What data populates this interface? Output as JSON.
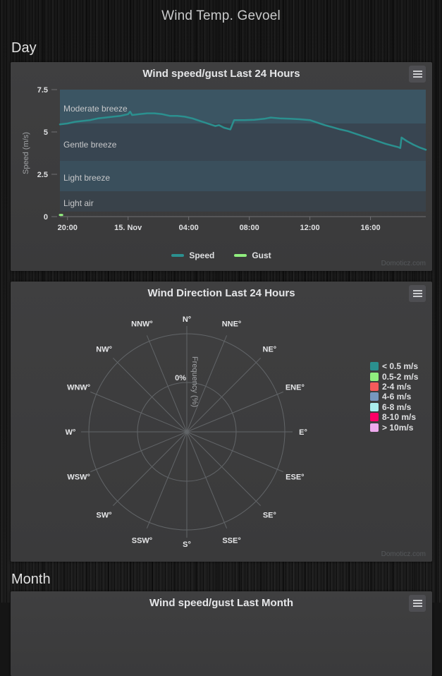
{
  "page": {
    "title": "Wind Temp. Gevoel",
    "sections": {
      "day": "Day",
      "month": "Month"
    },
    "watermark": "Domoticz.com"
  },
  "wind_speed_chart": {
    "title": "Wind speed/gust Last 24 Hours",
    "y_axis": {
      "title": "Speed (m/s)",
      "ticks": [
        {
          "label": "7.5",
          "v": 7.5
        },
        {
          "label": "5",
          "v": 5
        },
        {
          "label": "2.5",
          "v": 2.5
        },
        {
          "label": "0",
          "v": 0
        }
      ]
    },
    "x_ticks": [
      {
        "label": "20:00",
        "min": 30
      },
      {
        "label": "15. Nov",
        "min": 270
      },
      {
        "label": "04:00",
        "min": 510
      },
      {
        "label": "08:00",
        "min": 750
      },
      {
        "label": "12:00",
        "min": 990
      },
      {
        "label": "16:00",
        "min": 1230
      }
    ],
    "bands": [
      {
        "label": "Moderate breeze",
        "from": 5.5,
        "to": 7.5,
        "color": "#3b5563",
        "label_v": 6.2
      },
      {
        "label": "Gentle breeze",
        "from": 3.3,
        "to": 5.5,
        "color": "#384551",
        "label_v": 4.08
      },
      {
        "label": "Light breeze",
        "from": 1.5,
        "to": 3.3,
        "color": "#3a4f5c",
        "label_v": 2.12
      },
      {
        "label": "Light air",
        "from": 0.3,
        "to": 1.5,
        "color": "#39424a",
        "label_v": 0.62
      }
    ],
    "legend": [
      {
        "label": "Speed",
        "color": "#2b908f"
      },
      {
        "label": "Gust",
        "color": "#90ee7e"
      }
    ]
  },
  "wind_direction_chart": {
    "title": "Wind Direction Last 24 Hours",
    "axis_title": "Frequency (%)",
    "tick_label": "0%",
    "labels": [
      "N°",
      "NNE°",
      "NE°",
      "ENE°",
      "E°",
      "ESE°",
      "SE°",
      "SSE°",
      "S°",
      "SSW°",
      "SW°",
      "WSW°",
      "W°",
      "WNW°",
      "NW°",
      "NNW°"
    ],
    "legend": [
      {
        "label": "< 0.5 m/s",
        "color": "#2b908f"
      },
      {
        "label": "0.5-2 m/s",
        "color": "#90ee7e"
      },
      {
        "label": "2-4 m/s",
        "color": "#f45b5b"
      },
      {
        "label": "4-6 m/s",
        "color": "#7798bf"
      },
      {
        "label": "6-8 m/s",
        "color": "#aaeeee"
      },
      {
        "label": "8-10 m/s",
        "color": "#ff0066"
      },
      {
        "label": "> 10m/s",
        "color": "#eeaaee"
      }
    ]
  },
  "month_chart": {
    "title": "Wind speed/gust Last Month"
  },
  "chart_data": [
    {
      "type": "line",
      "title": "Wind speed/gust Last 24 Hours",
      "xlabel": "",
      "ylabel": "Speed (m/s)",
      "ylim": [
        0,
        7.5
      ],
      "x_span_minutes": 1449,
      "x_start_time": "19:30",
      "x_tick_labels": [
        "20:00",
        "15. Nov",
        "04:00",
        "08:00",
        "12:00",
        "16:00"
      ],
      "plot_band_labels": [
        "Moderate breeze",
        "Gentle breeze",
        "Light breeze",
        "Light air"
      ],
      "legend_position": "bottom",
      "grid": false,
      "series": [
        {
          "name": "Speed",
          "color": "#2b908f",
          "points": [
            [
              "19:30",
              5.45
            ],
            [
              "20:00",
              5.5
            ],
            [
              "20:30",
              5.6
            ],
            [
              "21:00",
              5.65
            ],
            [
              "21:30",
              5.7
            ],
            [
              "22:00",
              5.8
            ],
            [
              "22:30",
              5.85
            ],
            [
              "23:00",
              5.9
            ],
            [
              "23:30",
              5.95
            ],
            [
              "00:00",
              6.05
            ],
            [
              "00:08",
              6.2
            ],
            [
              "00:16",
              6.0
            ],
            [
              "00:45",
              6.05
            ],
            [
              "01:15",
              6.1
            ],
            [
              "01:45",
              6.1
            ],
            [
              "02:15",
              6.05
            ],
            [
              "02:45",
              5.95
            ],
            [
              "03:15",
              5.95
            ],
            [
              "03:45",
              5.9
            ],
            [
              "04:15",
              5.8
            ],
            [
              "04:45",
              5.65
            ],
            [
              "05:15",
              5.5
            ],
            [
              "05:45",
              5.35
            ],
            [
              "06:00",
              5.4
            ],
            [
              "06:20",
              5.25
            ],
            [
              "06:45",
              5.15
            ],
            [
              "07:00",
              5.7
            ],
            [
              "07:40",
              5.7
            ],
            [
              "08:20",
              5.72
            ],
            [
              "09:00",
              5.78
            ],
            [
              "09:25",
              5.85
            ],
            [
              "10:00",
              5.8
            ],
            [
              "10:40",
              5.78
            ],
            [
              "11:20",
              5.75
            ],
            [
              "12:00",
              5.7
            ],
            [
              "12:30",
              5.55
            ],
            [
              "13:00",
              5.4
            ],
            [
              "13:30",
              5.28
            ],
            [
              "14:00",
              5.15
            ],
            [
              "14:30",
              5.05
            ],
            [
              "15:00",
              4.9
            ],
            [
              "15:30",
              4.75
            ],
            [
              "16:00",
              4.6
            ],
            [
              "16:30",
              4.45
            ],
            [
              "17:00",
              4.3
            ],
            [
              "17:30",
              4.18
            ],
            [
              "17:50",
              4.1
            ],
            [
              "17:58",
              4.05
            ],
            [
              "18:03",
              4.67
            ],
            [
              "18:25",
              4.45
            ],
            [
              "18:50",
              4.25
            ],
            [
              "19:15",
              4.08
            ],
            [
              "19:39",
              3.95
            ]
          ]
        },
        {
          "name": "Gust",
          "color": "#90ee7e",
          "points": [
            [
              "19:30",
              0.1
            ],
            [
              "19:39",
              0.1
            ]
          ]
        }
      ]
    },
    {
      "type": "wind_rose",
      "title": "Wind Direction Last 24 Hours",
      "ylabel": "Frequency (%)",
      "y_tick_labels": [
        "0%"
      ],
      "categories": [
        "N",
        "NNE",
        "NE",
        "ENE",
        "E",
        "ESE",
        "SE",
        "SSE",
        "S",
        "SSW",
        "SW",
        "WSW",
        "W",
        "WNW",
        "NW",
        "NNW"
      ],
      "legend_position": "right",
      "series": [
        {
          "name": "< 0.5 m/s",
          "color": "#2b908f",
          "values": [
            0,
            0,
            0,
            0,
            0,
            0,
            0,
            0,
            0,
            0,
            0,
            0,
            0,
            0,
            0,
            0
          ]
        },
        {
          "name": "0.5-2 m/s",
          "color": "#90ee7e",
          "values": [
            0,
            0,
            0,
            0,
            0,
            0,
            0,
            0,
            0,
            0,
            0,
            0,
            0,
            0,
            0,
            0
          ]
        },
        {
          "name": "2-4 m/s",
          "color": "#f45b5b",
          "values": [
            0,
            0,
            0,
            0,
            0,
            0,
            0,
            0,
            0,
            0,
            0,
            0,
            0,
            0,
            0,
            0
          ]
        },
        {
          "name": "4-6 m/s",
          "color": "#7798bf",
          "values": [
            0,
            0,
            0,
            0,
            0,
            0,
            0,
            0,
            0,
            0,
            0,
            0,
            0,
            0,
            0,
            0
          ]
        },
        {
          "name": "6-8 m/s",
          "color": "#aaeeee",
          "values": [
            0,
            0,
            0,
            0,
            0,
            0,
            0,
            0,
            0,
            0,
            0,
            0,
            0,
            0,
            0,
            0
          ]
        },
        {
          "name": "8-10 m/s",
          "color": "#ff0066",
          "values": [
            0,
            0,
            0,
            0,
            0,
            0,
            0,
            0,
            0,
            0,
            0,
            0,
            0,
            0,
            0,
            0
          ]
        },
        {
          "name": "> 10m/s",
          "color": "#eeaaee",
          "values": [
            0,
            0,
            0,
            0,
            0,
            0,
            0,
            0,
            0,
            0,
            0,
            0,
            0,
            0,
            0,
            0
          ]
        }
      ]
    }
  ]
}
